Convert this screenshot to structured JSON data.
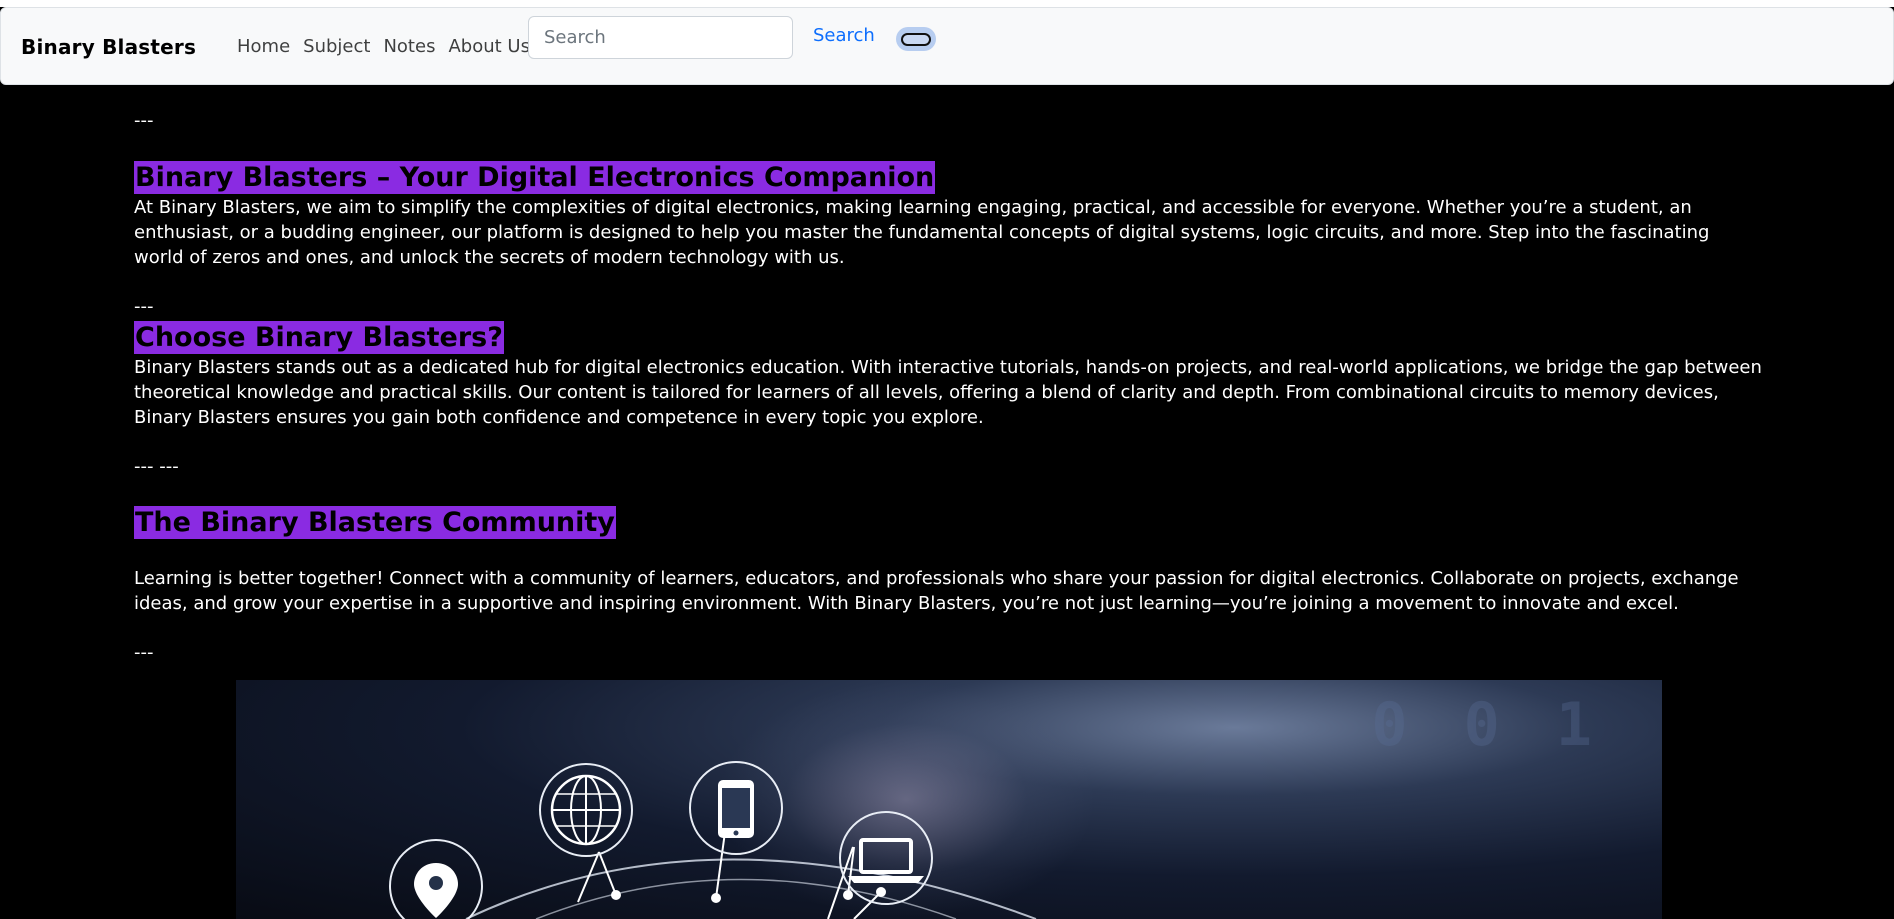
{
  "navbar": {
    "brand": "Binary Blasters",
    "links": [
      "Home",
      "Subject",
      "Notes",
      "About Us"
    ],
    "search": {
      "placeholder": "Search",
      "button_label": "Search"
    }
  },
  "content": {
    "separators": [
      "---",
      "---",
      "--- ---",
      "---"
    ],
    "section1": {
      "heading": "Binary Blasters – Your Digital Electronics Companion",
      "body": "At Binary Blasters, we aim to simplify the complexities of digital electronics, making learning engaging, practical, and accessible for everyone. Whether you’re a student, an enthusiast, or a budding engineer, our platform is designed to help you master the fundamental concepts of digital systems, logic circuits, and more. Step into the fascinating world of zeros and ones, and unlock the secrets of modern technology with us."
    },
    "section2": {
      "heading": "Choose Binary Blasters?",
      "body": "Binary Blasters stands out as a dedicated hub for digital electronics education. With interactive tutorials, hands-on projects, and real-world applications, we bridge the gap between theoretical knowledge and practical skills. Our content is tailored for learners of all levels, offering a blend of clarity and depth. From combinational circuits to memory devices, Binary Blasters ensures you gain both confidence and competence in every topic you explore."
    },
    "section3": {
      "heading": "The Binary Blasters Community",
      "body": "Learning is better together! Connect with a community of learners, educators, and professionals who share your passion for digital electronics. Collaborate on projects, exchange ideas, and grow your expertise in a supportive and inspiring environment. With Binary Blasters, you’re not just learning—you’re joining a movement to innovate and excel."
    }
  },
  "hero": {
    "icons": [
      "location-pin-icon",
      "globe-icon",
      "smartphone-icon",
      "laptop-icon"
    ]
  }
}
